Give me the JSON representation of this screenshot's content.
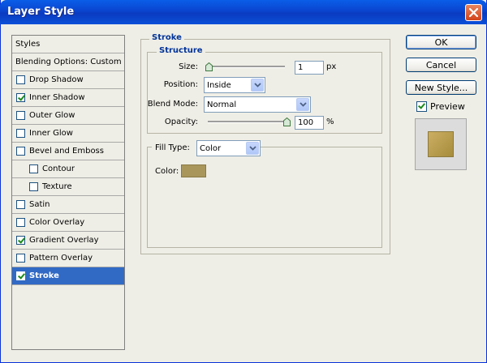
{
  "window": {
    "title": "Layer Style"
  },
  "styles_list": {
    "header": "Styles",
    "blending": "Blending Options: Custom",
    "items": [
      {
        "label": "Drop Shadow",
        "checked": false,
        "sub": false,
        "selected": false
      },
      {
        "label": "Inner Shadow",
        "checked": true,
        "sub": false,
        "selected": false
      },
      {
        "label": "Outer Glow",
        "checked": false,
        "sub": false,
        "selected": false
      },
      {
        "label": "Inner Glow",
        "checked": false,
        "sub": false,
        "selected": false
      },
      {
        "label": "Bevel and Emboss",
        "checked": false,
        "sub": false,
        "selected": false
      },
      {
        "label": "Contour",
        "checked": false,
        "sub": true,
        "selected": false
      },
      {
        "label": "Texture",
        "checked": false,
        "sub": true,
        "selected": false
      },
      {
        "label": "Satin",
        "checked": false,
        "sub": false,
        "selected": false
      },
      {
        "label": "Color Overlay",
        "checked": false,
        "sub": false,
        "selected": false
      },
      {
        "label": "Gradient Overlay",
        "checked": true,
        "sub": false,
        "selected": false
      },
      {
        "label": "Pattern Overlay",
        "checked": false,
        "sub": false,
        "selected": false
      },
      {
        "label": "Stroke",
        "checked": true,
        "sub": false,
        "selected": true
      }
    ]
  },
  "stroke": {
    "title": "Stroke",
    "structure_title": "Structure",
    "size_label": "Size:",
    "size_value": "1",
    "size_unit": "px",
    "position_label": "Position:",
    "position_value": "Inside",
    "blend_label": "Blend Mode:",
    "blend_value": "Normal",
    "opacity_label": "Opacity:",
    "opacity_value": "100",
    "opacity_unit": "%",
    "size_slider_fraction": 0.0,
    "opacity_slider_fraction": 1.0
  },
  "fill": {
    "type_label": "Fill Type:",
    "type_value": "Color",
    "color_label": "Color:",
    "color_hex": "#a8965b"
  },
  "buttons": {
    "ok": "OK",
    "cancel": "Cancel",
    "new_style": "New Style..."
  },
  "preview": {
    "label": "Preview",
    "checked": true
  },
  "colors": {
    "accent": "#316ac5",
    "title_bar": "#0a44cf",
    "group_title": "#003399"
  }
}
